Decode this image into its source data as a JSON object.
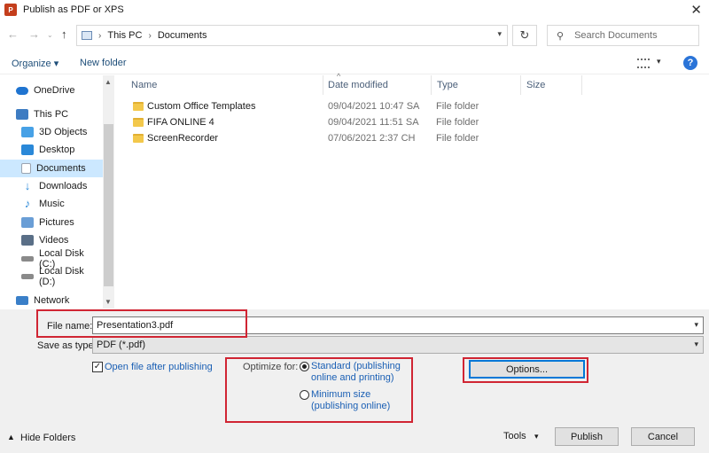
{
  "window": {
    "title": "Publish as PDF or XPS",
    "app_icon_letter": "P",
    "close_glyph": "✕"
  },
  "address": {
    "path": [
      "This PC",
      "Documents"
    ],
    "separator": "›",
    "search_placeholder": "Search Documents"
  },
  "toolbar": {
    "organize_label": "Organize ▾",
    "new_folder_label": "New folder",
    "help_label": "?"
  },
  "sidebar": {
    "items": [
      {
        "label": "OneDrive",
        "icon": "cloud-icon",
        "color": "#1f74d0"
      },
      {
        "label": "This PC",
        "icon": "computer-icon",
        "color": "#3e7cc2"
      },
      {
        "label": "3D Objects",
        "icon": "cube-icon",
        "color": "#47a1e6"
      },
      {
        "label": "Desktop",
        "icon": "desktop-icon",
        "color": "#2a88d8"
      },
      {
        "label": "Documents",
        "icon": "document-icon",
        "color": "#9aa4b1",
        "selected": true
      },
      {
        "label": "Downloads",
        "icon": "download-icon",
        "color": "#2a88d8"
      },
      {
        "label": "Music",
        "icon": "music-icon",
        "color": "#2a88d8"
      },
      {
        "label": "Pictures",
        "icon": "pictures-icon",
        "color": "#6a9ed6"
      },
      {
        "label": "Videos",
        "icon": "videos-icon",
        "color": "#5a6f87"
      },
      {
        "label": "Local Disk (C:)",
        "icon": "drive-icon",
        "color": "#8a8a8a"
      },
      {
        "label": "Local Disk (D:)",
        "icon": "drive-icon",
        "color": "#8a8a8a"
      },
      {
        "label": "Network",
        "icon": "network-icon",
        "color": "#3a7fc8"
      }
    ]
  },
  "files": {
    "columns": [
      "Name",
      "Date modified",
      "Type",
      "Size"
    ],
    "rows": [
      {
        "name": "Custom Office Templates",
        "date": "09/04/2021 10:47 SA",
        "type": "File folder",
        "size": ""
      },
      {
        "name": "FIFA ONLINE 4",
        "date": "09/04/2021 11:51 SA",
        "type": "File folder",
        "size": ""
      },
      {
        "name": "ScreenRecorder",
        "date": "07/06/2021 2:37 CH",
        "type": "File folder",
        "size": ""
      }
    ]
  },
  "form": {
    "file_name_label": "File name:",
    "file_name_value": "Presentation3.pdf",
    "save_type_label": "Save as type:",
    "save_type_value": "PDF (*.pdf)",
    "open_after_label": "Open file after publishing",
    "open_after_checked": true,
    "optimize_label": "Optimize for:",
    "opt_standard_line1": "Standard (publishing",
    "opt_standard_line2": "online and printing)",
    "opt_min_line1": "Minimum size",
    "opt_min_line2": "(publishing online)",
    "selected_optimization": "standard",
    "options_label": "Options..."
  },
  "footer": {
    "hide_folders_label": "Hide Folders",
    "tools_label": "Tools",
    "publish_label": "Publish",
    "cancel_label": "Cancel"
  },
  "colors": {
    "highlight_box": "#d02533",
    "selection": "#cce8ff",
    "link": "#1a5fb4"
  }
}
